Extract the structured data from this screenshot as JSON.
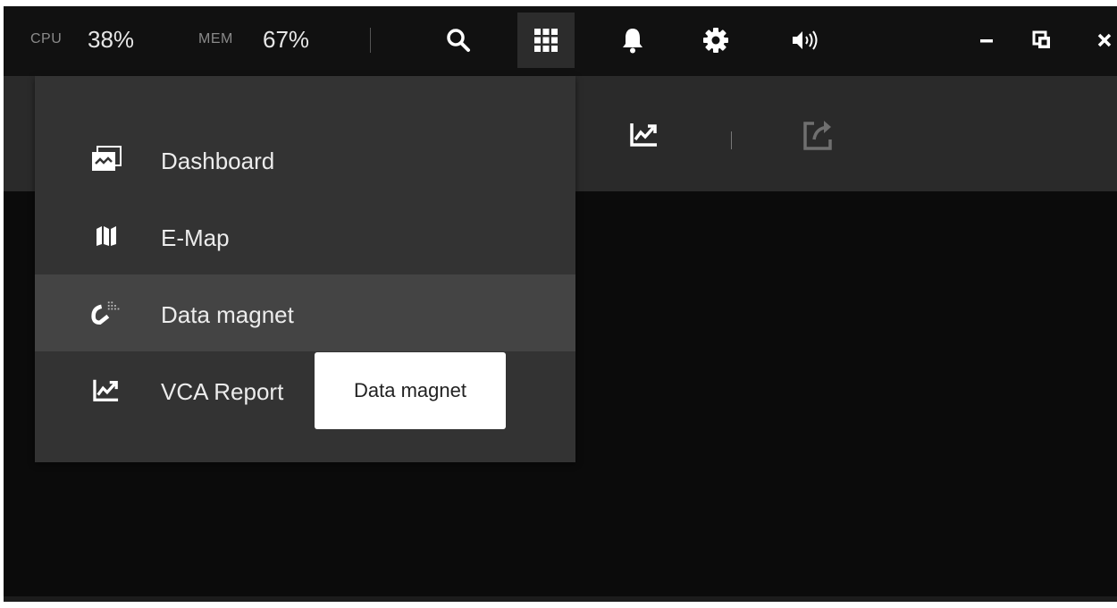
{
  "topbar": {
    "cpu_label": "CPU",
    "cpu_value": "38%",
    "mem_label": "MEM",
    "mem_value": "67%",
    "icons": [
      "search-icon",
      "app-grid-icon",
      "bell-icon",
      "gear-icon",
      "speaker-icon"
    ],
    "window_controls": [
      "minimize-icon",
      "restore-icon",
      "close-icon"
    ]
  },
  "subbar": {
    "icons": [
      "vca-report-icon",
      "export-icon"
    ]
  },
  "menu": {
    "items": [
      {
        "label": "Dashboard",
        "icon": "dashboard-icon"
      },
      {
        "label": "E-Map",
        "icon": "map-icon"
      },
      {
        "label": "Data magnet",
        "icon": "magnet-icon",
        "highlighted": true
      },
      {
        "label": "VCA Report",
        "icon": "report-chart-icon"
      }
    ]
  },
  "tooltip": {
    "text": "Data magnet"
  },
  "colors": {
    "background": "#0b0b0b",
    "topbar": "#111111",
    "subbar": "#2a2a2a",
    "menu": "#333333",
    "menu_highlight": "#444444",
    "tooltip": "#ffffff"
  }
}
